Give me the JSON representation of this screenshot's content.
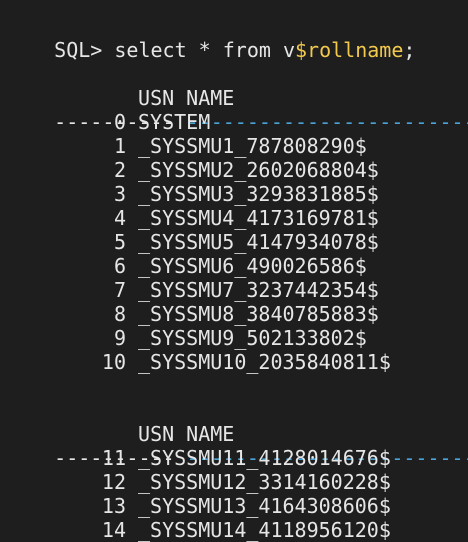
{
  "prompt": {
    "sql_prefix": "SQL> ",
    "cmd": "select * from v",
    "object": "$rollname",
    "terminator": ";"
  },
  "block1": {
    "col_usn": "USN",
    "col_name": "NAME",
    "dash_left": "----------",
    "dash_right": "-----------------------------",
    "rows": [
      {
        "usn": "0",
        "name": "SYSTEM"
      },
      {
        "usn": "1",
        "name": "_SYSSMU1_787808290$"
      },
      {
        "usn": "2",
        "name": "_SYSSMU2_2602068804$"
      },
      {
        "usn": "3",
        "name": "_SYSSMU3_3293831885$"
      },
      {
        "usn": "4",
        "name": "_SYSSMU4_4173169781$"
      },
      {
        "usn": "5",
        "name": "_SYSSMU5_4147934078$"
      },
      {
        "usn": "6",
        "name": "_SYSSMU6_490026586$"
      },
      {
        "usn": "7",
        "name": "_SYSSMU7_3237442354$"
      },
      {
        "usn": "8",
        "name": "_SYSSMU8_3840785883$"
      },
      {
        "usn": "9",
        "name": "_SYSSMU9_502133802$"
      },
      {
        "usn": "10",
        "name": "_SYSSMU10_2035840811$"
      }
    ]
  },
  "block2": {
    "col_usn": "USN",
    "col_name": "NAME",
    "dash_left": "----------",
    "dash_right": "-----------------------------",
    "rows": [
      {
        "usn": "11",
        "name": "_SYSSMU11_4128014676$"
      },
      {
        "usn": "12",
        "name": "_SYSSMU12_3314160228$"
      },
      {
        "usn": "13",
        "name": "_SYSSMU13_4164308606$"
      },
      {
        "usn": "14",
        "name": "_SYSSMU14_4118956120$"
      }
    ]
  }
}
